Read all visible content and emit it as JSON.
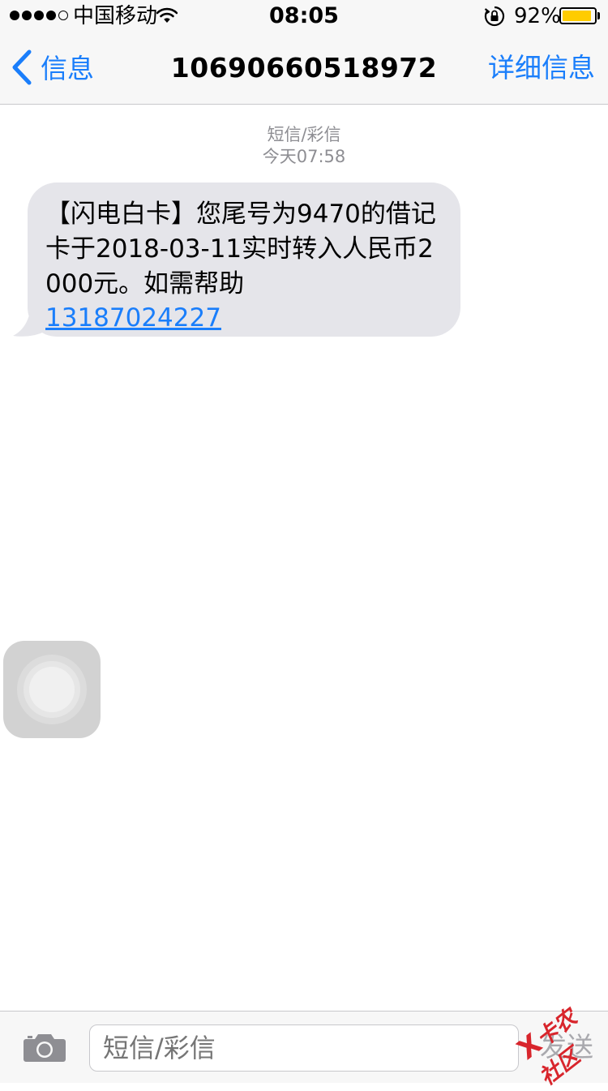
{
  "status_bar": {
    "carrier": "中国移动",
    "time": "08:05",
    "battery_percent": "92%",
    "battery_level": 0.92,
    "signal_bars_filled": 4,
    "signal_bars_total": 5,
    "battery_color": "#ffcc00"
  },
  "nav": {
    "back_label": "信息",
    "title": "10690660518972",
    "details_label": "详细信息",
    "accent_color": "#1a7efb"
  },
  "thread": {
    "message_type": "短信/彩信",
    "timestamp": "今天07:58",
    "messages": [
      {
        "text": "【闪电白卡】您尾号为9470的借记卡于2018-03-11实时转入人民币2000元。如需帮助",
        "link": "13187024227",
        "direction": "incoming"
      }
    ]
  },
  "compose": {
    "placeholder": "短信/彩信",
    "send_label": "发送"
  },
  "watermark": {
    "mark": "X",
    "text": "卡农社区"
  }
}
